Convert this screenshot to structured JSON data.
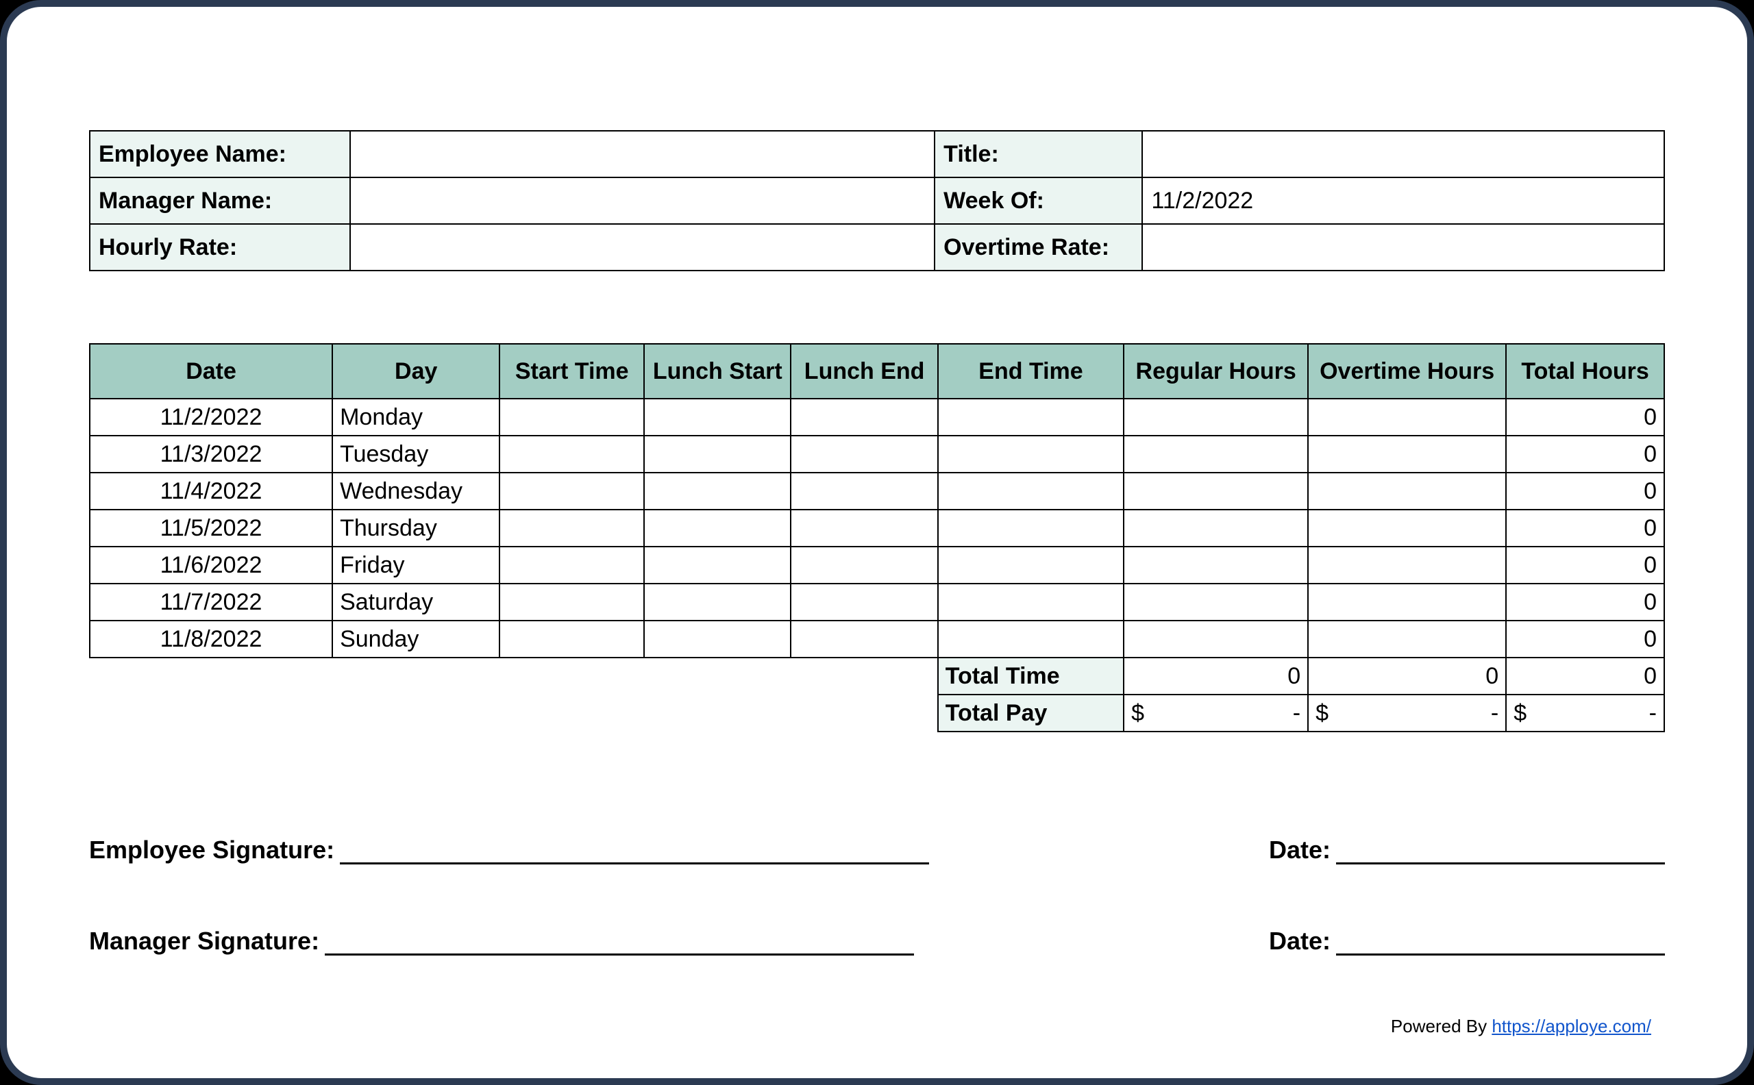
{
  "info": {
    "employee_name_label": "Employee Name:",
    "employee_name_value": "",
    "title_label": "Title:",
    "title_value": "",
    "manager_name_label": "Manager Name:",
    "manager_name_value": "",
    "week_of_label": "Week Of:",
    "week_of_value": "11/2/2022",
    "hourly_rate_label": "Hourly Rate:",
    "hourly_rate_value": "",
    "overtime_rate_label": "Overtime Rate:",
    "overtime_rate_value": ""
  },
  "columns": {
    "date": "Date",
    "day": "Day",
    "start": "Start Time",
    "lunch_start": "Lunch Start",
    "lunch_end": "Lunch End",
    "end": "End Time",
    "regular": "Regular Hours",
    "overtime": "Overtime Hours",
    "total": "Total Hours"
  },
  "rows": [
    {
      "date": "11/2/2022",
      "day": "Monday",
      "start": "",
      "lunch_start": "",
      "lunch_end": "",
      "end": "",
      "regular": "",
      "overtime": "",
      "total": "0"
    },
    {
      "date": "11/3/2022",
      "day": "Tuesday",
      "start": "",
      "lunch_start": "",
      "lunch_end": "",
      "end": "",
      "regular": "",
      "overtime": "",
      "total": "0"
    },
    {
      "date": "11/4/2022",
      "day": "Wednesday",
      "start": "",
      "lunch_start": "",
      "lunch_end": "",
      "end": "",
      "regular": "",
      "overtime": "",
      "total": "0"
    },
    {
      "date": "11/5/2022",
      "day": "Thursday",
      "start": "",
      "lunch_start": "",
      "lunch_end": "",
      "end": "",
      "regular": "",
      "overtime": "",
      "total": "0"
    },
    {
      "date": "11/6/2022",
      "day": "Friday",
      "start": "",
      "lunch_start": "",
      "lunch_end": "",
      "end": "",
      "regular": "",
      "overtime": "",
      "total": "0"
    },
    {
      "date": "11/7/2022",
      "day": "Saturday",
      "start": "",
      "lunch_start": "",
      "lunch_end": "",
      "end": "",
      "regular": "",
      "overtime": "",
      "total": "0"
    },
    {
      "date": "11/8/2022",
      "day": "Sunday",
      "start": "",
      "lunch_start": "",
      "lunch_end": "",
      "end": "",
      "regular": "",
      "overtime": "",
      "total": "0"
    }
  ],
  "summary": {
    "total_time_label": "Total Time",
    "total_time_regular": "0",
    "total_time_overtime": "0",
    "total_time_total": "0",
    "total_pay_label": "Total Pay",
    "currency": "$",
    "pay_regular": "-",
    "pay_overtime": "-",
    "pay_total": "-"
  },
  "signatures": {
    "employee_label": "Employee Signature:",
    "manager_label": "Manager Signature:",
    "date_label": "Date:"
  },
  "footer": {
    "powered_by": "Powered By ",
    "link_text": "https://apploye.com/"
  }
}
